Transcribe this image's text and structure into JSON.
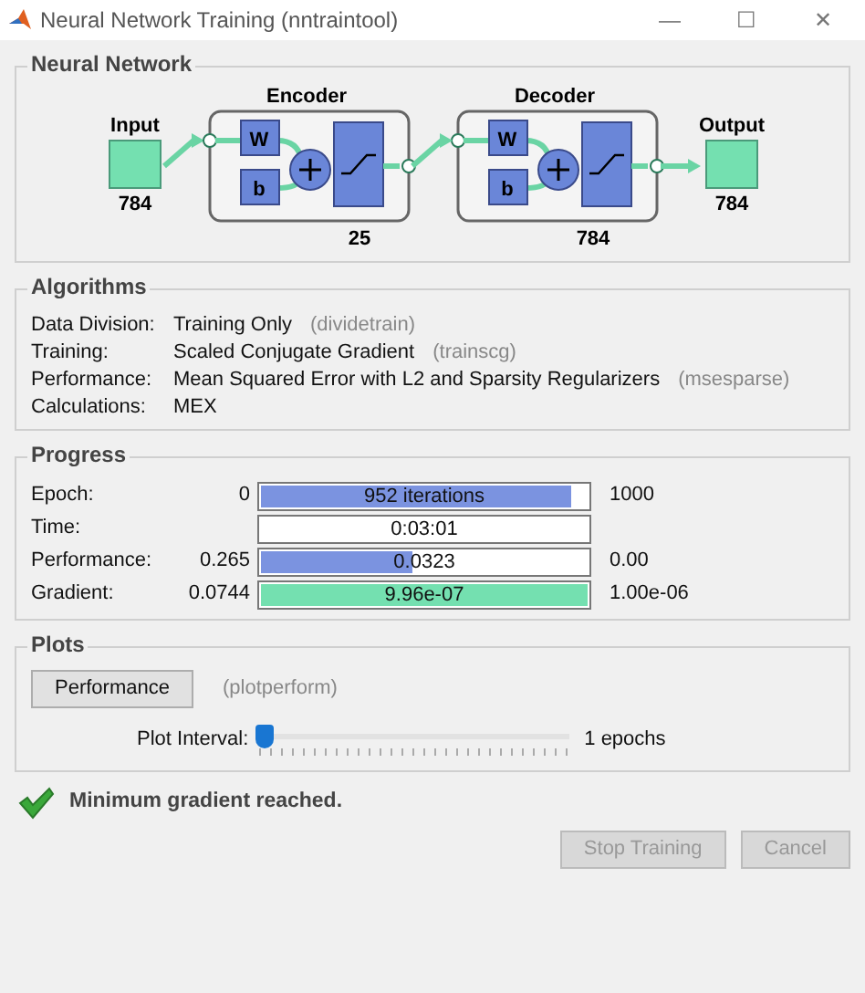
{
  "window": {
    "title": "Neural Network Training (nntraintool)",
    "controls": [
      "—",
      "☐",
      "✕"
    ]
  },
  "neural_network": {
    "title": "Neural Network",
    "input": {
      "label": "Input",
      "size": "784"
    },
    "output": {
      "label": "Output",
      "size": "784"
    },
    "layers": [
      {
        "label": "Encoder",
        "size": "25",
        "weight": "W",
        "bias": "b"
      },
      {
        "label": "Decoder",
        "size": "784",
        "weight": "W",
        "bias": "b"
      }
    ]
  },
  "algorithms": {
    "title": "Algorithms",
    "rows": [
      {
        "label": "Data Division:",
        "value": "Training Only",
        "function": "(dividetrain)"
      },
      {
        "label": "Training:",
        "value": "Scaled Conjugate Gradient",
        "function": "(trainscg)"
      },
      {
        "label": "Performance:",
        "value": "Mean Squared Error with L2 and Sparsity Regularizers",
        "function": "(msesparse)"
      },
      {
        "label": "Calculations:",
        "value": "MEX"
      }
    ]
  },
  "progress": {
    "title": "Progress",
    "rows": [
      {
        "label": "Epoch:",
        "start": "0",
        "reading": "952 iterations",
        "level": 0.952,
        "reached": false,
        "end": "1000"
      },
      {
        "label": "Time:",
        "reading": "0:03:01"
      },
      {
        "label": "Performance:",
        "start": "0.265",
        "reading": "0.0323",
        "level": 0.47,
        "reached": false,
        "end": "0.00"
      },
      {
        "label": "Gradient:",
        "start": "0.0744",
        "reading": "9.96e-07",
        "level": 1,
        "reached": true,
        "end": "1.00e-06"
      }
    ]
  },
  "plots": {
    "title": "Plots",
    "buttons": [
      {
        "label": "Performance",
        "function": "(plotperform)"
      }
    ],
    "interval": {
      "label": "Plot Interval:",
      "level": 0,
      "reading": "1 epochs"
    }
  },
  "status": {
    "text": "Minimum gradient reached.",
    "ok": true
  },
  "buttons": [
    {
      "label": "Stop Training",
      "disabled": true
    },
    {
      "label": "Cancel",
      "disabled": true
    }
  ]
}
